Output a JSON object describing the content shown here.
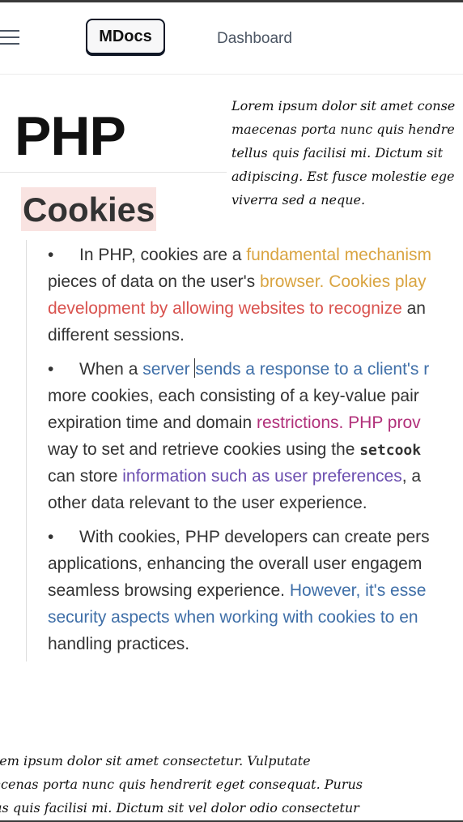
{
  "header": {
    "logo_label": "MDocs",
    "nav_dashboard": "Dashboard"
  },
  "page": {
    "title": "PHP",
    "section_heading": "Cookies"
  },
  "floating_note": {
    "lines": [
      "Lorem ipsum dolor sit amet conse",
      "maecenas porta nunc quis hendre",
      "tellus quis facilisi mi. Dictum sit",
      "adipiscing. Est fusce molestie ege",
      "viverra sed a neque."
    ]
  },
  "colors": {
    "text": "#333333",
    "orange": "#d9a441",
    "red": "#d9534f",
    "blue": "#3f6fa8",
    "magenta": "#b1307a",
    "purple": "#6c4fb0",
    "highlight": "#f9e3e1"
  },
  "content": {
    "bullet": "•",
    "p1": {
      "l1_a": "In PHP, cookies are a ",
      "l1_b": "fundamental mechanism",
      "l2_a": "pieces of data on the user's ",
      "l2_b": "browser. Cookies play",
      "l3_a": "development by allowing websites to recognize ",
      "l3_b": "an",
      "l4": "different sessions."
    },
    "p2": {
      "l1_a": "When a ",
      "l1_b": "server ",
      "l1_c": "sends a response to a client's r",
      "l2": "more cookies, each consisting of a key-value pair",
      "l3_a": "expiration time and domain ",
      "l3_b": "restrictions. PHP prov",
      "l4_a": "way to set and retrieve cookies using the ",
      "l4_code": "setcook",
      "l5_a": "can store ",
      "l5_b": "information such as user preferences",
      "l5_c": ", a",
      "l6": "other data relevant to the user experience."
    },
    "p3": {
      "l1": "With cookies, PHP developers can create pers",
      "l2": "applications, enhancing the overall user engagem",
      "l3_a": "seamless browsing experience. ",
      "l3_b": "However, it's esse",
      "l4": "security aspects when working with cookies to en",
      "l5": "handling practices."
    }
  },
  "bottom_note": {
    "lines": [
      "orem ipsum dolor sit amet consectetur. Vulputate",
      "aecenas porta nunc quis hendrerit eget consequat. Purus",
      "llus quis facilisi mi. Dictum sit vel dolor odio consectetur"
    ]
  }
}
